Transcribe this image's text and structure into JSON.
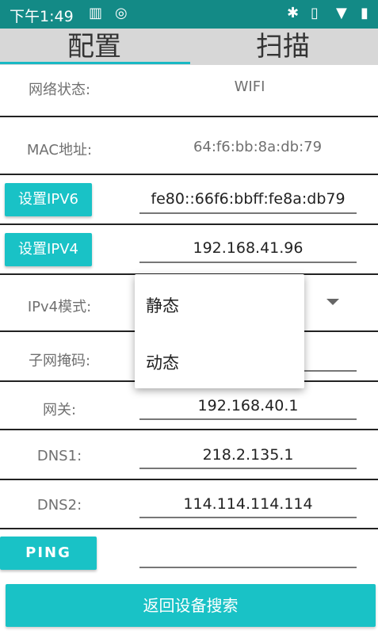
{
  "status_bar": {
    "time": "下午1:49",
    "icons": [
      "sim-icon",
      "clock-app-icon",
      "bluetooth-icon",
      "vibrate-icon",
      "wifi-icon",
      "battery-icon"
    ]
  },
  "tabs": [
    {
      "label": "配置",
      "active": true
    },
    {
      "label": "扫描",
      "active": false
    }
  ],
  "rows": {
    "network_status": {
      "label": "网络状态:",
      "value": "WIFI"
    },
    "mac": {
      "label": "MAC地址:",
      "value": "64:f6:bb:8a:db:79"
    },
    "ipv6": {
      "button": "设置IPV6",
      "value": "fe80::66f6:bbff:fe8a:db79"
    },
    "ipv4": {
      "button": "设置IPV4",
      "value": "192.168.41.96"
    },
    "ipv4_mode": {
      "label": "IPv4模式:"
    },
    "subnet": {
      "label": "子网掩码:",
      "value": ""
    },
    "gateway": {
      "label": "网关:",
      "value": "192.168.40.1"
    },
    "dns1": {
      "label": "DNS1:",
      "value": "218.2.135.1"
    },
    "dns2": {
      "label": "DNS2:",
      "value": "114.114.114.114"
    },
    "ping": {
      "button": "PING",
      "value": ""
    }
  },
  "dropdown": {
    "options": [
      "静态",
      "动态"
    ]
  },
  "bottom_button": "返回设备搜索",
  "colors": {
    "status_bar": "#138a86",
    "accent": "#19c2c6",
    "tab_bar": "#d7d7d7"
  }
}
